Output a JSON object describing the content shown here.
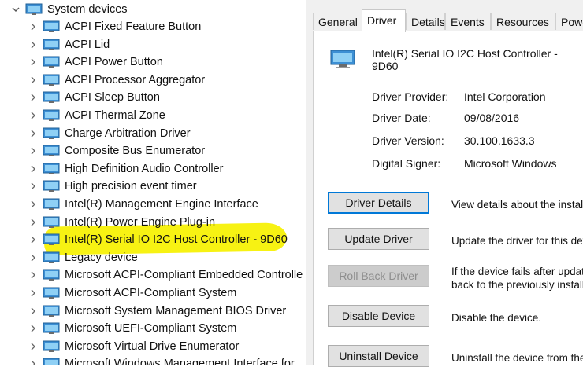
{
  "tree": {
    "category": {
      "label": "System devices",
      "expanded": true
    },
    "items": [
      {
        "label": "ACPI Fixed Feature Button"
      },
      {
        "label": "ACPI Lid"
      },
      {
        "label": "ACPI Power Button"
      },
      {
        "label": "ACPI Processor Aggregator"
      },
      {
        "label": "ACPI Sleep Button"
      },
      {
        "label": "ACPI Thermal Zone"
      },
      {
        "label": "Charge Arbitration Driver"
      },
      {
        "label": "Composite Bus Enumerator"
      },
      {
        "label": "High Definition Audio Controller"
      },
      {
        "label": "High precision event timer"
      },
      {
        "label": "Intel(R) Management Engine Interface"
      },
      {
        "label": "Intel(R) Power Engine Plug-in"
      },
      {
        "label": "Intel(R) Serial IO I2C Host Controller - 9D60",
        "highlighted": true
      },
      {
        "label": "Legacy device"
      },
      {
        "label": "Microsoft ACPI-Compliant Embedded Controlle"
      },
      {
        "label": "Microsoft ACPI-Compliant System"
      },
      {
        "label": "Microsoft System Management BIOS Driver"
      },
      {
        "label": "Microsoft UEFI-Compliant System"
      },
      {
        "label": "Microsoft Virtual Drive Enumerator"
      },
      {
        "label": "Microsoft Windows Management Interface for"
      }
    ],
    "highlight_color": "#f7f213"
  },
  "dialog": {
    "tabs": [
      {
        "label": "General"
      },
      {
        "label": "Driver",
        "active": true
      },
      {
        "label": "Details"
      },
      {
        "label": "Events"
      },
      {
        "label": "Resources"
      },
      {
        "label": "Powe"
      }
    ],
    "device_name": "Intel(R) Serial IO I2C Host Controller - 9D60",
    "properties": [
      {
        "key": "Driver Provider:",
        "value": "Intel Corporation"
      },
      {
        "key": "Driver Date:",
        "value": "09/08/2016"
      },
      {
        "key": "Driver Version:",
        "value": "30.100.1633.3"
      },
      {
        "key": "Digital Signer:",
        "value": "Microsoft Windows"
      }
    ],
    "actions": [
      {
        "button": "Driver Details",
        "desc": [
          "View details about the installe"
        ],
        "focused": true
      },
      {
        "button": "Update Driver",
        "desc": [
          "Update the driver for this dev"
        ]
      },
      {
        "button": "Roll Back Driver",
        "desc": [
          "If the device fails after updati",
          "back to the previously installe"
        ],
        "disabled": true
      },
      {
        "button": "Disable Device",
        "desc": [
          "Disable the device."
        ]
      },
      {
        "button": "Uninstall Device",
        "desc": [
          "Uninstall the device from the"
        ]
      }
    ],
    "accent_color": "#0078d7"
  }
}
